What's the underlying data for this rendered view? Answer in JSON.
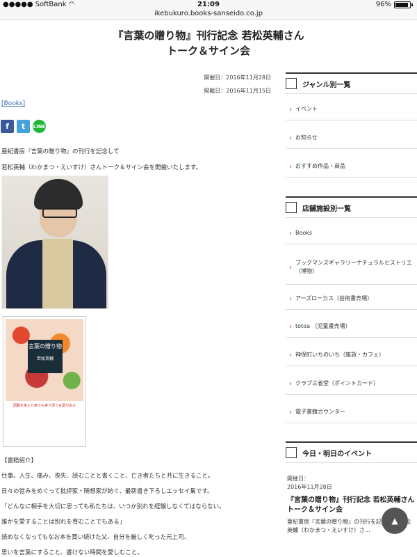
{
  "status": {
    "carrier": "SoftBank",
    "time": "21:09",
    "battery": "96%",
    "url": "ikebukuro.books-sanseido.co.jp"
  },
  "article": {
    "title_line1": "『言葉の贈り物』刊行記念 若松英輔さん",
    "title_line2": "トーク＆サイン会",
    "date_held": "開催日：2016年11月28日",
    "date_posted": "掲載日：2016年11月15日",
    "books_link": "[Books]",
    "lines": [
      "亜紀書房『言葉の贈り物』の刊行を記念して",
      "若松英輔（わかまつ・えいすけ）さんトーク＆サイン会を開催いたします。"
    ],
    "book_cover": {
      "title": "言葉の贈り物",
      "author": "若松英輔",
      "tagline": "困難を抱えた時でも寄り添う言葉がある"
    },
    "book_intro_label": "【書籍紹介】",
    "intro_lines": [
      "仕事、人生、痛み、喪失、読むことと書くこと、亡き者たちと共に生きること。",
      "日々の営みをめぐって批評家・随想家が紡ぐ、最新書き下ろしエッセイ集です。",
      "「どんなに相手を大切に思っても私たちは、いつか別れを経験しなくてはならない。",
      "誰かを愛することは別れを育むことでもある」",
      "読めなくなってもなお本を買い続けた父、自分を厳しく叱った元上司、",
      "思いを言葉にすること、書けない時間を愛しむこと。"
    ]
  },
  "share": {
    "facebook": "f",
    "twitter": "t",
    "line": "LINE"
  },
  "sidebar": {
    "genre_heading": "ジャンル別一覧",
    "genre_items": [
      "イベント",
      "お知らせ",
      "おすすめ作品・商品"
    ],
    "store_heading": "店舗施設別一覧",
    "store_items": [
      "Books",
      "ブックマンズギャラリーナチュラルヒストリエ（博物）",
      "アーズローカス（芸術書売場）",
      "totoa （児童書売場）",
      "神保町いちのいち（雑貨・カフェ）",
      "クラブ三省堂（ポイントカード）",
      "電子書籍カウンター"
    ],
    "event_heading": "今日・明日のイベント",
    "event_date_label": "開催日：",
    "event_date": "2016年11月28日",
    "event_title": "『言葉の贈り物』刊行記念 若松英輔さんトーク＆サイン会",
    "event_desc": "亜紀書房『言葉の贈り物』の刊行を記念して 若松英輔（わかまつ・えいすけ）さ..."
  },
  "scroll_top_icon": "arrow-up-icon"
}
